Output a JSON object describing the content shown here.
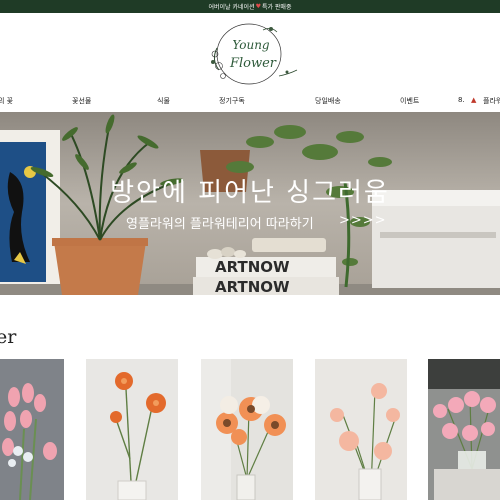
{
  "topbar": {
    "text_before": "어버이날 카네이션",
    "text_after": "특가 판매중"
  },
  "logo": {
    "line1": "Young",
    "line2": "Flower"
  },
  "nav": {
    "items": [
      "의 꽃",
      "꽃선물",
      "식물",
      "정기구독",
      "당일배송",
      "이벤트",
      "8.",
      "플라워"
    ]
  },
  "hero": {
    "title": "방안에 피어난 싱그러움",
    "subtitle": "영플라워의 플라워테리어 따라하기",
    "arrow": ">>>>",
    "book_text_1": "ARTNOW",
    "book_text_2": "ARTNOW"
  },
  "section": {
    "title": "er"
  },
  "colors": {
    "topbar_bg": "#1f3b26",
    "accent_green": "#2e5a3a",
    "sale_red": "#c0392b"
  }
}
